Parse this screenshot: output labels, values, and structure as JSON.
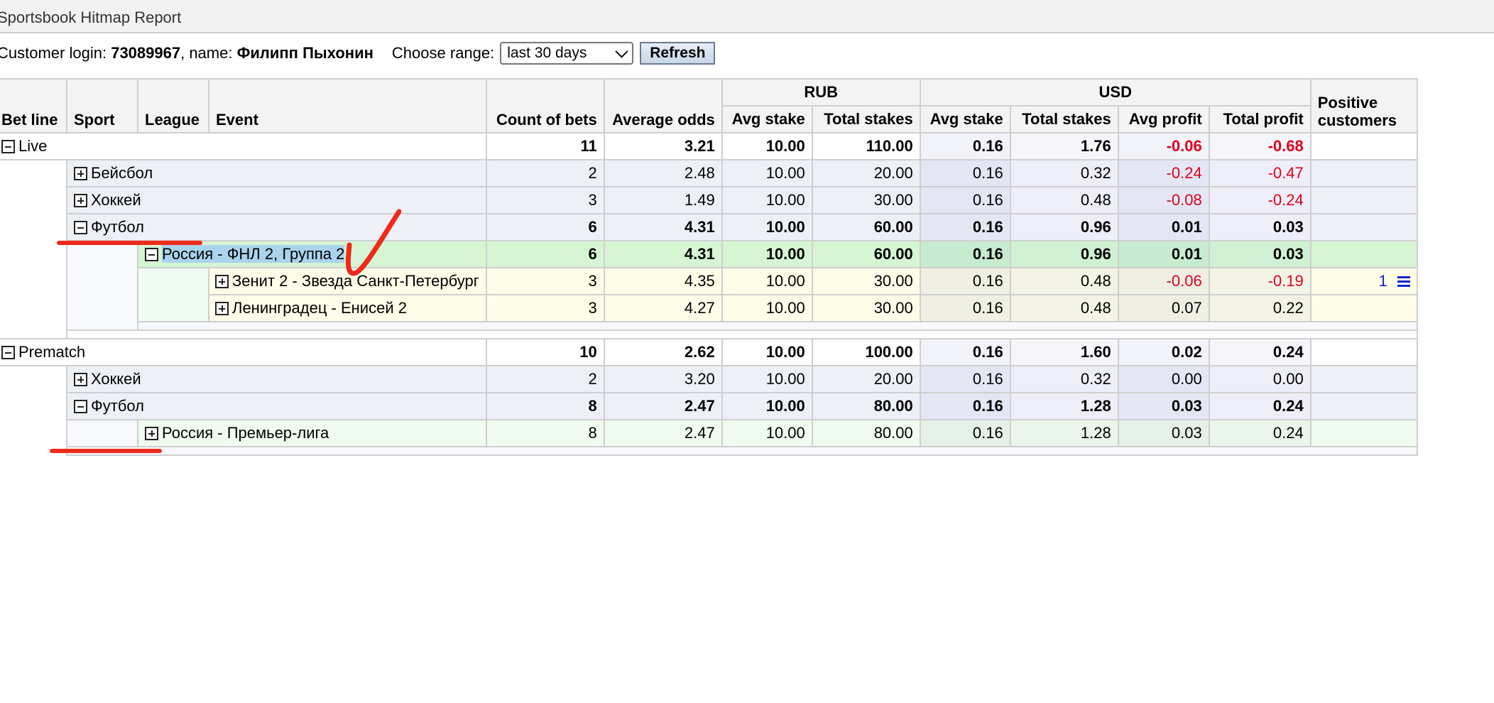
{
  "window": {
    "title": "Sportsbook Hitmap Report"
  },
  "customer": {
    "login_label": "Customer login:",
    "login": "73089967",
    "name_label": ", name:",
    "name": "Филипп Пыхонин"
  },
  "range": {
    "label": "Choose range:",
    "selected": "last 30 days"
  },
  "refresh_label": "Refresh",
  "table": {
    "groups": {
      "rub": "RUB",
      "usd": "USD"
    },
    "headers": {
      "bet_line": "Bet line",
      "sport": "Sport",
      "league": "League",
      "event": "Event",
      "count": "Count of bets",
      "avg_odds": "Average odds",
      "rub_avg_stake": "Avg stake",
      "rub_total_stakes": "Total stakes",
      "usd_avg_stake": "Avg stake",
      "usd_total_stakes": "Total stakes",
      "avg_profit": "Avg profit",
      "total_profit": "Total profit",
      "positive_customers": "Positive customers"
    },
    "rows": {
      "live": {
        "name": "Live",
        "count": "11",
        "odds": "3.21",
        "rub_avg": "10.00",
        "rub_total": "110.00",
        "usd_avg": "0.16",
        "usd_total": "1.76",
        "avg_profit": "-0.06",
        "total_profit": "-0.68"
      },
      "live_baseball": {
        "name": "Бейсбол",
        "count": "2",
        "odds": "2.48",
        "rub_avg": "10.00",
        "rub_total": "20.00",
        "usd_avg": "0.16",
        "usd_total": "0.32",
        "avg_profit": "-0.24",
        "total_profit": "-0.47"
      },
      "live_hockey": {
        "name": "Хоккей",
        "count": "3",
        "odds": "1.49",
        "rub_avg": "10.00",
        "rub_total": "30.00",
        "usd_avg": "0.16",
        "usd_total": "0.48",
        "avg_profit": "-0.08",
        "total_profit": "-0.24"
      },
      "live_football": {
        "name": "Футбол",
        "count": "6",
        "odds": "4.31",
        "rub_avg": "10.00",
        "rub_total": "60.00",
        "usd_avg": "0.16",
        "usd_total": "0.96",
        "avg_profit": "0.01",
        "total_profit": "0.03"
      },
      "live_league": {
        "name": "Россия - ФНЛ 2, Группа 2",
        "count": "6",
        "odds": "4.31",
        "rub_avg": "10.00",
        "rub_total": "60.00",
        "usd_avg": "0.16",
        "usd_total": "0.96",
        "avg_profit": "0.01",
        "total_profit": "0.03"
      },
      "event1": {
        "name": "Зенит 2 - Звезда Санкт-Петербург",
        "count": "3",
        "odds": "4.35",
        "rub_avg": "10.00",
        "rub_total": "30.00",
        "usd_avg": "0.16",
        "usd_total": "0.48",
        "avg_profit": "-0.06",
        "total_profit": "-0.19",
        "positive": "1"
      },
      "event2": {
        "name": "Ленинградец - Енисей 2",
        "count": "3",
        "odds": "4.27",
        "rub_avg": "10.00",
        "rub_total": "30.00",
        "usd_avg": "0.16",
        "usd_total": "0.48",
        "avg_profit": "0.07",
        "total_profit": "0.22"
      },
      "prematch": {
        "name": "Prematch",
        "count": "10",
        "odds": "2.62",
        "rub_avg": "10.00",
        "rub_total": "100.00",
        "usd_avg": "0.16",
        "usd_total": "1.60",
        "avg_profit": "0.02",
        "total_profit": "0.24"
      },
      "pm_hockey": {
        "name": "Хоккей",
        "count": "2",
        "odds": "3.20",
        "rub_avg": "10.00",
        "rub_total": "20.00",
        "usd_avg": "0.16",
        "usd_total": "0.32",
        "avg_profit": "0.00",
        "total_profit": "0.00"
      },
      "pm_football": {
        "name": "Футбол",
        "count": "8",
        "odds": "2.47",
        "rub_avg": "10.00",
        "rub_total": "80.00",
        "usd_avg": "0.16",
        "usd_total": "1.28",
        "avg_profit": "0.03",
        "total_profit": "0.24"
      },
      "pm_league": {
        "name": "Россия - Премьер-лига",
        "count": "8",
        "odds": "2.47",
        "rub_avg": "10.00",
        "rub_total": "80.00",
        "usd_avg": "0.16",
        "usd_total": "1.28",
        "avg_profit": "0.03",
        "total_profit": "0.24"
      }
    }
  },
  "colors": {
    "negative": "#e0001b",
    "annotation": "#ee2a1a",
    "link": "#1024d6",
    "league_row": "#d5f5d3",
    "event_row": "#fefde8"
  }
}
